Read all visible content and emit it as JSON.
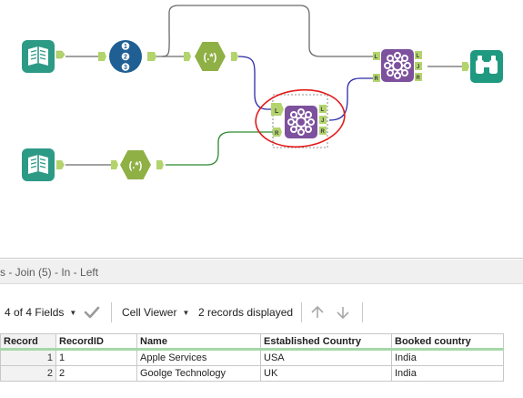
{
  "colors": {
    "input_tool": "#2d9a86",
    "recordid_tool": "#1f5f93",
    "regex_tool": "#8fb045",
    "join_tool": "#7d519d",
    "browse_tool": "#1f9a80",
    "anchor": "#b3d46d",
    "wire_grey": "#6a6a6a",
    "wire_blue": "#2a2aa8",
    "wire_green": "#2c8a2c",
    "annotation_red": "#e31b1b"
  },
  "icons": {
    "input_1": "book-icon",
    "input_2": "book-icon",
    "record_id": "record-id-123-icon",
    "regex_1": "regex-icon",
    "regex_2": "regex-icon",
    "join_selected": "join-icon",
    "join_2": "join-icon",
    "browse": "binoculars-icon"
  },
  "workflow": {
    "record_id_digits": [
      "1",
      "2",
      "3"
    ],
    "regex_symbol": "(.*)",
    "join_left_anchor": "L",
    "join_right_anchor": "R",
    "join_output_left": "L",
    "join_output_join": "J",
    "join_output_right": "R"
  },
  "results": {
    "title": "s - Join (5) - In - Left",
    "fields_selector": "4 of 4 Fields",
    "viewer_selector": "Cell Viewer",
    "records_displayed": "2 records displayed",
    "columns": [
      "Record",
      "RecordID",
      "Name",
      "Established Country",
      "Booked country"
    ],
    "rows": [
      [
        "1",
        "1",
        "Apple Services",
        "USA",
        "India"
      ],
      [
        "2",
        "2",
        "Goolge Technology",
        "UK",
        "India"
      ]
    ]
  }
}
